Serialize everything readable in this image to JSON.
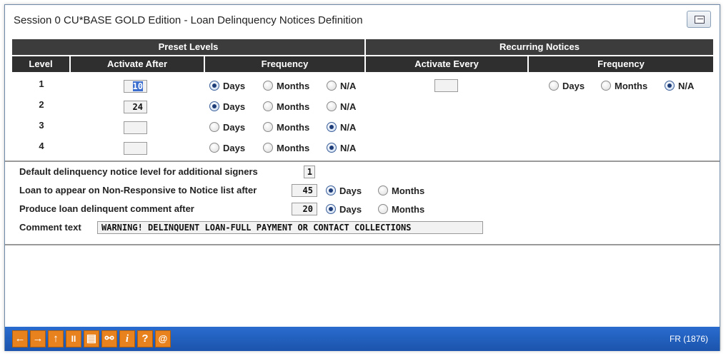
{
  "window": {
    "title": "Session 0 CU*BASE GOLD Edition - Loan Delinquency Notices Definition",
    "restore_icon": "window-restore-icon"
  },
  "headers": {
    "preset_levels": "Preset Levels",
    "recurring_notices": "Recurring Notices",
    "level": "Level",
    "activate_after": "Activate After",
    "frequency": "Frequency",
    "activate_every": "Activate Every",
    "frequency2": "Frequency"
  },
  "radio_labels": {
    "days": "Days",
    "months": "Months",
    "na": "N/A"
  },
  "levels": [
    {
      "level": "1",
      "activate_after": "10",
      "frequency": "Days"
    },
    {
      "level": "2",
      "activate_after": "24",
      "frequency": "Days"
    },
    {
      "level": "3",
      "activate_after": "",
      "frequency": "N/A"
    },
    {
      "level": "4",
      "activate_after": "",
      "frequency": "N/A"
    }
  ],
  "recurring": {
    "activate_every": "",
    "frequency": "N/A"
  },
  "settings": {
    "default_level_label": "Default delinquency notice level for additional signers",
    "default_level_value": "1",
    "nonresponsive_label": "Loan to appear on Non-Responsive to Notice list after",
    "nonresponsive_value": "45",
    "nonresponsive_unit": "Days",
    "comment_after_label": "Produce loan delinquent comment after",
    "comment_after_value": "20",
    "comment_after_unit": "Days",
    "comment_text_label": "Comment text",
    "comment_text_value": "WARNING! DELINQUENT LOAN-FULL PAYMENT OR CONTACT COLLECTIONS"
  },
  "footer": {
    "buttons": [
      {
        "name": "back-arrow-icon",
        "glyph": "←"
      },
      {
        "name": "forward-arrow-icon",
        "glyph": "→"
      },
      {
        "name": "up-arrow-icon",
        "glyph": "↑"
      },
      {
        "name": "pause-icon",
        "glyph": "II"
      },
      {
        "name": "print-icon",
        "glyph": "▤"
      },
      {
        "name": "link-icon",
        "glyph": "⚯"
      },
      {
        "name": "info-icon",
        "glyph": "i"
      },
      {
        "name": "help-icon",
        "glyph": "?"
      },
      {
        "name": "email-icon",
        "glyph": "@"
      }
    ],
    "screen_code": "FR (1876)"
  }
}
